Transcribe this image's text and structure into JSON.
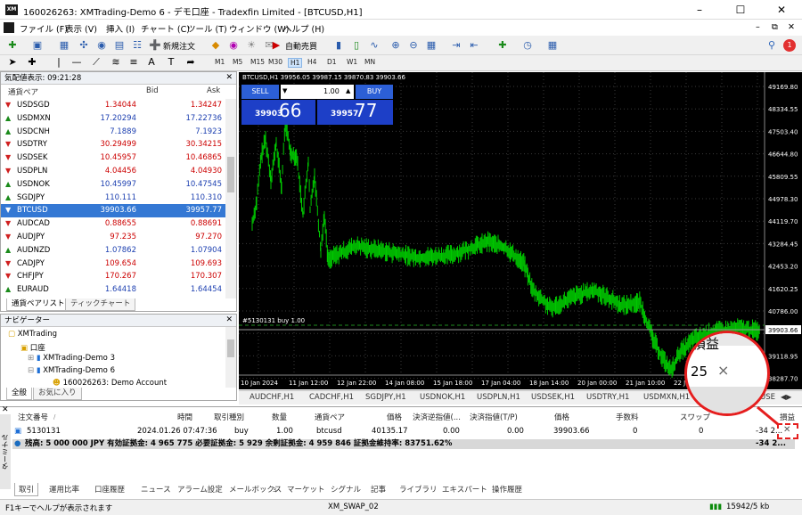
{
  "window": {
    "title": "160026263: XMTrading-Demo 6 - デモ口座 - Tradexfin Limited - [BTCUSD,H1]",
    "logo": "XM"
  },
  "menu": [
    "ファイル (F)",
    "表示 (V)",
    "挿入 (I)",
    "チャート (C)",
    "ツール (T)",
    "ウィンドウ (W)",
    "ヘルプ (H)"
  ],
  "toolbar": {
    "new_order": "新規注文",
    "auto_trade": "自動売買",
    "alert_count": "1"
  },
  "timeframes": [
    "M1",
    "M5",
    "M15",
    "M30",
    "H1",
    "H4",
    "D1",
    "W1",
    "MN"
  ],
  "market_watch": {
    "title": "気配値表示: 09:21:28",
    "col_symbol": "通貨ペア",
    "col_bid": "Bid",
    "col_ask": "Ask",
    "rows": [
      {
        "sym": "USDSGD",
        "bid": "1.34044",
        "ask": "1.34247"
      },
      {
        "sym": "USDMXN",
        "bid": "17.20294",
        "ask": "17.22736"
      },
      {
        "sym": "USDCNH",
        "bid": "7.1889",
        "ask": "7.1923"
      },
      {
        "sym": "USDTRY",
        "bid": "30.29499",
        "ask": "30.34215"
      },
      {
        "sym": "USDSEK",
        "bid": "10.45957",
        "ask": "10.46865"
      },
      {
        "sym": "USDPLN",
        "bid": "4.04456",
        "ask": "4.04930"
      },
      {
        "sym": "USDNOK",
        "bid": "10.45997",
        "ask": "10.47545"
      },
      {
        "sym": "SGDJPY",
        "bid": "110.111",
        "ask": "110.310"
      },
      {
        "sym": "BTCUSD",
        "bid": "39903.66",
        "ask": "39957.77"
      },
      {
        "sym": "AUDCAD",
        "bid": "0.88655",
        "ask": "0.88691"
      },
      {
        "sym": "AUDJPY",
        "bid": "97.235",
        "ask": "97.270"
      },
      {
        "sym": "AUDNZD",
        "bid": "1.07862",
        "ask": "1.07904"
      },
      {
        "sym": "CADJPY",
        "bid": "109.654",
        "ask": "109.693"
      },
      {
        "sym": "CHFJPY",
        "bid": "170.267",
        "ask": "170.307"
      },
      {
        "sym": "EURAUD",
        "bid": "1.64418",
        "ask": "1.64454"
      }
    ],
    "tabs": [
      "通貨ペアリスト",
      "ティックチャート"
    ]
  },
  "navigator": {
    "title": "ナビゲーター",
    "items": [
      "XMTrading",
      "口座",
      "XMTrading-Demo 3",
      "XMTrading-Demo 6",
      "160026263: Demo Account"
    ],
    "tabs": [
      "全般",
      "お気に入り"
    ]
  },
  "chart": {
    "title": "BTCUSD,H1  39956.05 39987.15 39870.83 39903.66",
    "sell_label": "SELL",
    "buy_label": "BUY",
    "lot": "1.00",
    "sell_small": "39903",
    "sell_big": "66",
    "buy_small": "39957",
    "buy_big": "77",
    "order_line": "#5130131 buy 1.00",
    "price_labels": [
      "49169.80",
      "48334.55",
      "47503.40",
      "46644.80",
      "45809.55",
      "44978.30",
      "44119.70",
      "43284.45",
      "42453.20",
      "41620.25",
      "40786.00",
      "39903.66",
      "39118.95",
      "38287.70"
    ],
    "time_labels": [
      "10 Jan 2024",
      "11 Jan 12:00",
      "12 Jan 22:00",
      "14 Jan 08:00",
      "15 Jan 18:00",
      "17 Jan 04:00",
      "18 Jan 14:00",
      "20 Jan 00:00",
      "21 Jan 10:00",
      "22 Jan 20:00",
      "23"
    ]
  },
  "symbol_tabs": [
    "AUDCHF,H1",
    "CADCHF,H1",
    "SGDJPY,H1",
    "USDNOK,H1",
    "USDPLN,H1",
    "USDSEK,H1",
    "USDTRY,H1",
    "USDMXN,H1",
    "USE"
  ],
  "terminal": {
    "side_label": "ターミナル",
    "headers": [
      "注文番号",
      "時間",
      "取引種別",
      "数量",
      "通貨ペア",
      "価格",
      "決済逆指値(...",
      "決済指値(T/P)",
      "価格",
      "手数料",
      "スワップ",
      "損益"
    ],
    "row": [
      "5130131",
      "2024.01.26 07:47:36",
      "buy",
      "1.00",
      "btcusd",
      "40135.17",
      "0.00",
      "0.00",
      "39903.66",
      "0",
      "0",
      "-34 2..."
    ],
    "balance": "残高: 5 000 000 JPY  有効証拠金: 4 965 775  必要証拠金: 5 929  余剰証拠金: 4 959 846  証拠金維持率: 83751.62%",
    "balance_pl": "-34 2...",
    "tabs": [
      "取引",
      "運用比率",
      "口座履歴",
      "ニュース",
      "アラーム設定",
      "メールボックス",
      "マーケット",
      "シグナル",
      "記事",
      "ライブラリ",
      "エキスパート",
      "操作履歴"
    ],
    "mailbox_count": "3"
  },
  "magnifier": {
    "text_top": "損益",
    "num": "25",
    "x": "×"
  },
  "status": {
    "help": "F1キーでヘルプが表示されます",
    "profile": "XM_SWAP_02",
    "traffic": "15942/5 kb"
  }
}
